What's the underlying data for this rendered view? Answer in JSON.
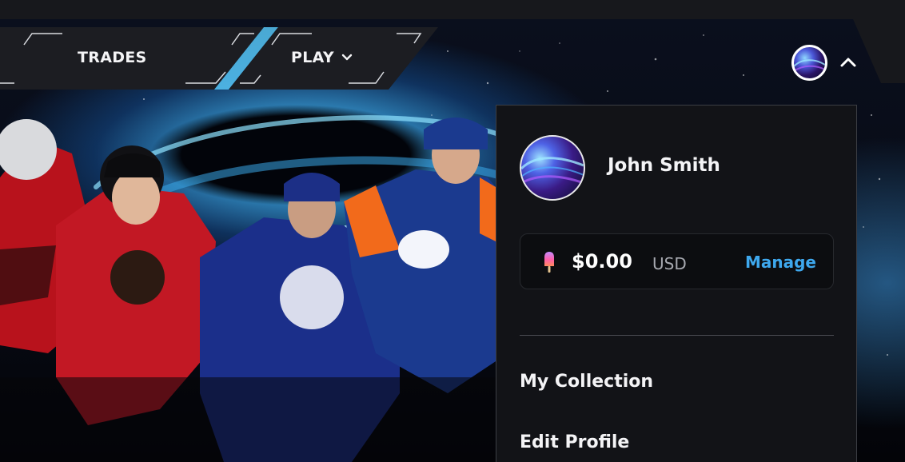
{
  "nav": {
    "tabs": [
      {
        "label": "TRADES"
      },
      {
        "label": "PLAY"
      }
    ]
  },
  "account_menu": {
    "user_name": "John Smith",
    "wallet": {
      "balance": "$0.00",
      "currency": "USD",
      "manage_label": "Manage"
    },
    "items": [
      {
        "label": "My Collection"
      },
      {
        "label": "Edit Profile"
      }
    ]
  },
  "icons": {
    "play_dropdown": "chevron-down-icon",
    "menu_toggle": "chevron-up-icon",
    "wallet": "popsicle-icon"
  },
  "colors": {
    "accent": "#3ea8ee",
    "panel": "#121317",
    "wallet_bg": "#0c0d10",
    "nav_bg": "#1c1d22"
  }
}
